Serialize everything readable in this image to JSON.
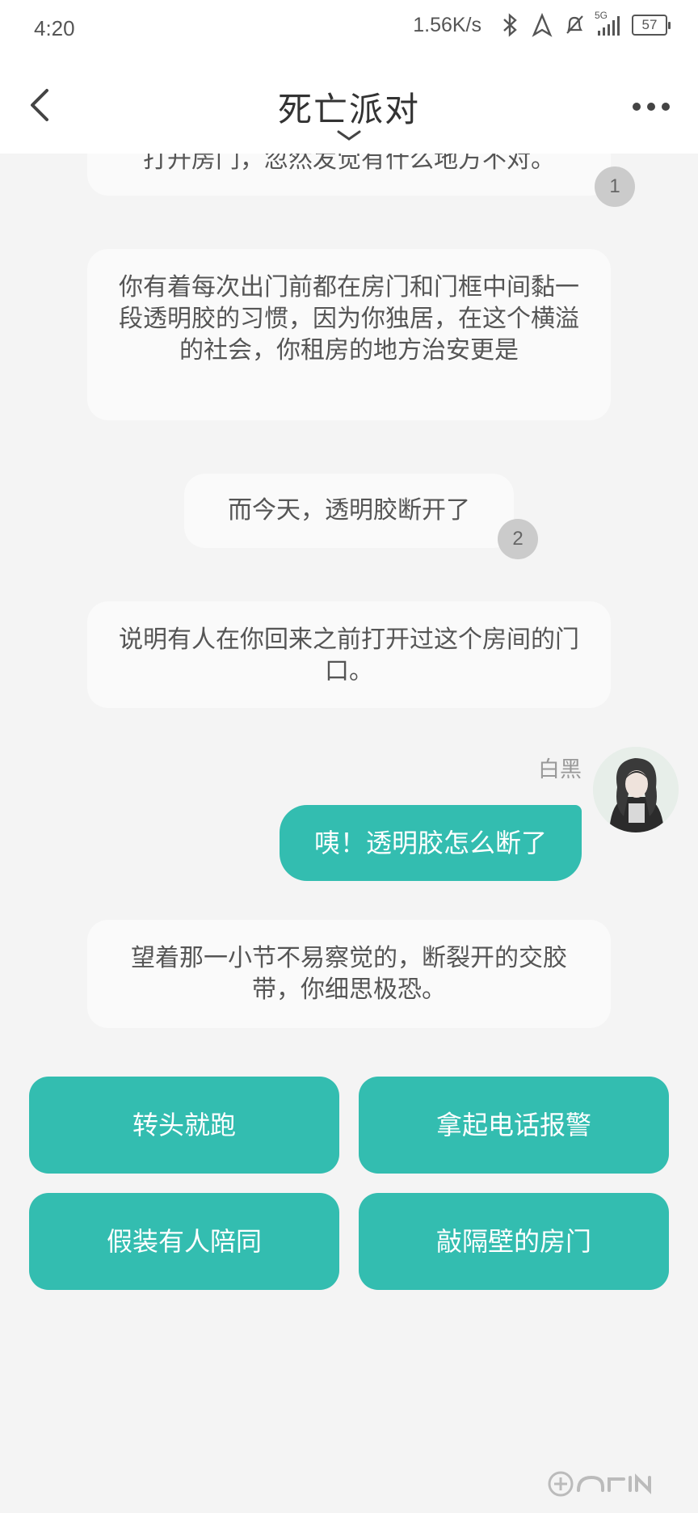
{
  "status_bar": {
    "time": "4:20",
    "network_speed": "1.56K/s",
    "signal_label": "5G",
    "battery": "57",
    "icons": [
      "bluetooth-icon",
      "location-icon",
      "mute-icon",
      "signal-icon",
      "battery-icon"
    ]
  },
  "header": {
    "title": "死亡派对",
    "back_icon": "back-arrow-icon",
    "more_icon": "more-dots-icon",
    "chevron_icon": "chevron-down-icon"
  },
  "messages": [
    {
      "text": "打开房门，忽然发觉有什么地方不对。",
      "badge": "1"
    },
    {
      "text": "你有着每次出门前都在房门和门框中间黏一段透明胶的习惯，因为你独居，在这个横溢的社会，你租房的地方治安更是"
    },
    {
      "text": "而今天，透明胶断开了",
      "badge": "2"
    },
    {
      "text": "说明有人在你回来之前打开过这个房间的门口。"
    },
    {
      "user_name": "白黑",
      "text": "咦！透明胶怎么断了"
    },
    {
      "text": "望着那一小节不易察觉的，断裂开的交胶带，你细思极恐。"
    }
  ],
  "choices": [
    "转头就跑",
    "拿起电话报警",
    "假装有人陪同",
    "敲隔壁的房门"
  ],
  "colors": {
    "accent": "#33bdb0",
    "background": "#f4f4f4",
    "bubble": "#fafafa"
  }
}
